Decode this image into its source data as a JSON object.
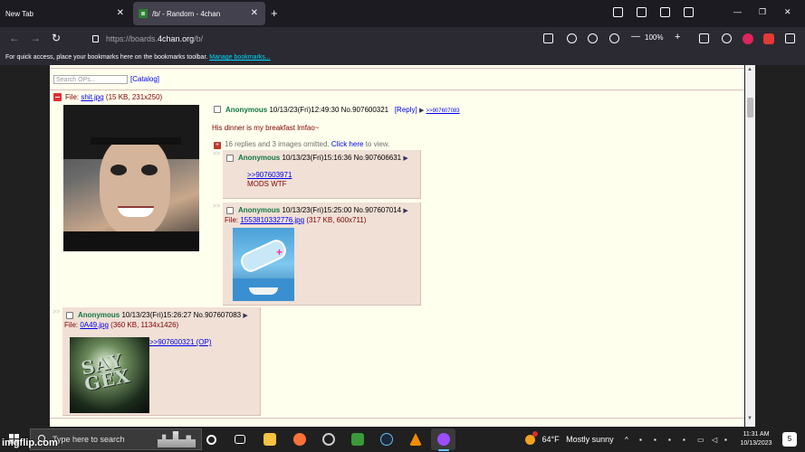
{
  "browser": {
    "tabs": [
      {
        "title": "New Tab",
        "active": false
      },
      {
        "title": "/b/ - Random - 4chan",
        "active": true
      }
    ],
    "url_prefix": "https://boards.",
    "url_host": "4chan.org",
    "url_path": "/b/",
    "zoom": "100%",
    "bookmarks_message": "For quick access, place your bookmarks here on the bookmarks toolbar.",
    "bookmarks_link": "Manage bookmarks..."
  },
  "board": {
    "search_placeholder": "Search OPs...",
    "catalog_label": "[Catalog]"
  },
  "op": {
    "file_label": "File: ",
    "file_name": "shit.jpg",
    "file_meta": " (15 KB, 231x250)",
    "name": "Anonymous",
    "datetime": "10/13/23(Fri)12:49:30",
    "post_no": "No.907600321",
    "reply_label": "[Reply]",
    "backlink": ">>907607083",
    "comment": "His dinner is my breakfast lmfao~",
    "omitted_prefix": "16 replies and 3 images omitted.",
    "omitted_link": "Click here",
    "omitted_suffix": "to view."
  },
  "replies": [
    {
      "name": "Anonymous",
      "datetime": "10/13/23(Fri)15:16:36",
      "post_no": "No.907606631",
      "quote": ">>907603971",
      "comment": "MODS WTF"
    },
    {
      "name": "Anonymous",
      "datetime": "10/13/23(Fri)15:25:00",
      "post_no": "No.907607014",
      "file_label": "File: ",
      "file_name": "1553810332776.jpg",
      "file_meta": " (317 KB, 600x711)"
    },
    {
      "name": "Anonymous",
      "datetime": "10/13/23(Fri)15:26:27",
      "post_no": "No.907607083",
      "file_label": "File: ",
      "file_name": "0A49.jpg",
      "file_meta": " (360 KB, 1134x1426)",
      "quote": ">>907600321 (OP)",
      "image_text": "SAY GEX"
    }
  ],
  "taskbar": {
    "search_placeholder": "Type here to search",
    "temperature": "64°F",
    "weather": "Mostly sunny",
    "time": "11:31 AM",
    "date": "10/13/2023",
    "notifications": "5"
  },
  "watermark": "imgflip.com",
  "colors": {
    "page_bg": "#ffffee",
    "reply_bg": "#f0e0d6",
    "name_green": "#117743",
    "text_maroon": "#800000",
    "link_blue": "#0000ee"
  }
}
